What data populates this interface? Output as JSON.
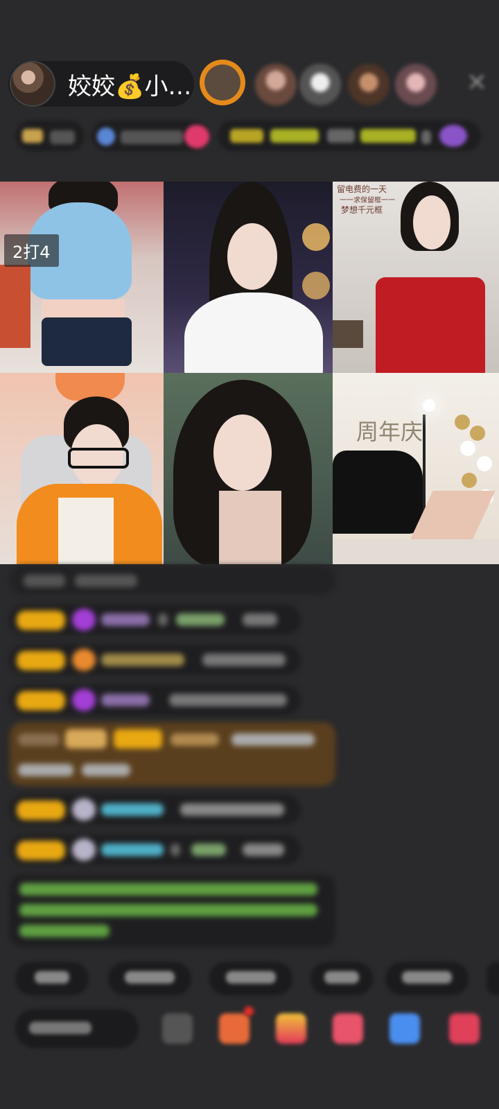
{
  "header": {
    "host_name": "姣姣💰小…",
    "close_icon": "close-icon"
  },
  "grid": {
    "tile1_badge": "2打4",
    "tile3_caption_top": "留电费的一天",
    "tile3_caption_mid": "一一求保留框一一",
    "tile3_caption_bot": "梦想千元框",
    "tile6_caption": "周年庆"
  },
  "colors": {
    "background": "#2a2a2c",
    "pill": "#1c1c1e",
    "badge_gold": "#e8a812",
    "chat_green": "#6fbf4a",
    "chat_blue": "#4fb0c6"
  }
}
